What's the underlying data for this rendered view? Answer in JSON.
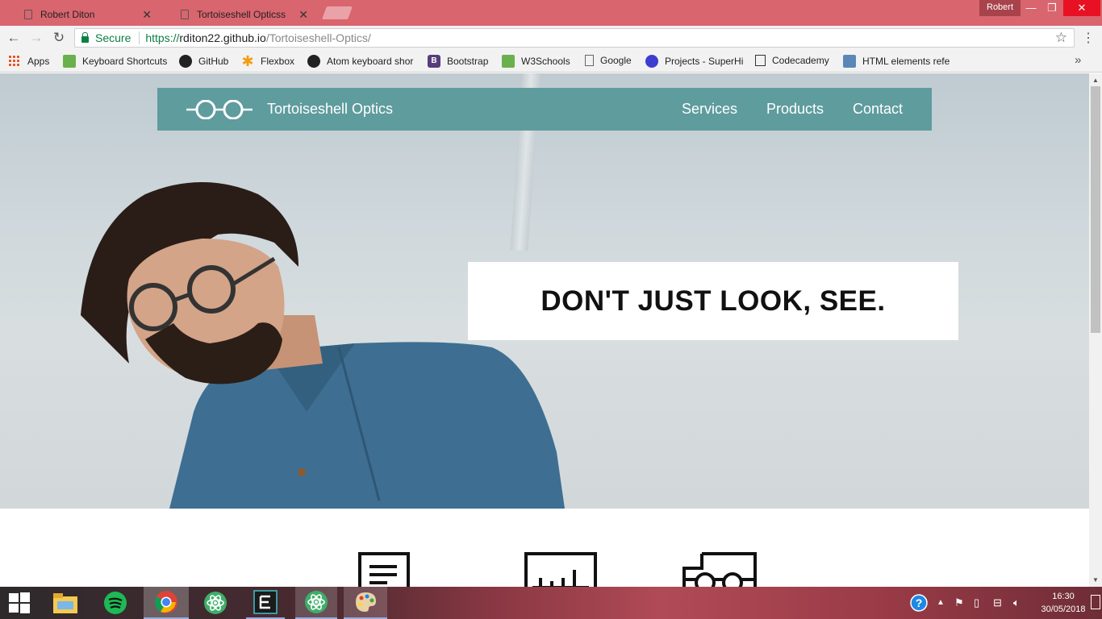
{
  "browser": {
    "tabs": [
      {
        "title": "Robert Diton",
        "active": false
      },
      {
        "title": "Tortoiseshell Opticss",
        "active": true
      }
    ],
    "profile_name": "Robert",
    "address": {
      "secure_label": "Secure",
      "url_scheme": "https://",
      "url_host": "rditon22.github.io",
      "url_path": "/Tortoiseshell-Optics/"
    },
    "bookmarks": [
      {
        "label": "Apps",
        "icon": "apps-grid-icon"
      },
      {
        "label": "Keyboard Shortcuts",
        "icon": "w3-icon"
      },
      {
        "label": "GitHub",
        "icon": "github-icon"
      },
      {
        "label": "Flexbox",
        "icon": "asterisk-icon"
      },
      {
        "label": "Atom keyboard shor",
        "icon": "github-icon"
      },
      {
        "label": "Bootstrap",
        "icon": "bootstrap-icon"
      },
      {
        "label": "W3Schools",
        "icon": "w3-icon"
      },
      {
        "label": "Google",
        "icon": "page-icon"
      },
      {
        "label": "Projects - SuperHi",
        "icon": "superhi-icon"
      },
      {
        "label": "Codecademy",
        "icon": "codecademy-icon"
      },
      {
        "label": "HTML elements refe",
        "icon": "html-icon"
      }
    ]
  },
  "site": {
    "brand": "Tortoiseshell Optics",
    "nav": [
      "Services",
      "Products",
      "Contact"
    ],
    "tagline": "DON'T JUST LOOK, SEE.",
    "nav_color": "#5f9c9e",
    "features": [
      {
        "icon": "document-icon"
      },
      {
        "icon": "ruler-icon"
      },
      {
        "icon": "glasses-box-icon"
      }
    ]
  },
  "taskbar": {
    "apps": [
      {
        "name": "file-explorer-icon",
        "state": "normal"
      },
      {
        "name": "spotify-icon",
        "state": "normal"
      },
      {
        "name": "chrome-icon",
        "state": "active"
      },
      {
        "name": "atom-icon",
        "state": "normal"
      },
      {
        "name": "editor-icon",
        "state": "open"
      },
      {
        "name": "atom-icon",
        "state": "open"
      },
      {
        "name": "paint-icon",
        "state": "open"
      }
    ],
    "time": "16:30",
    "date": "30/05/2018"
  }
}
